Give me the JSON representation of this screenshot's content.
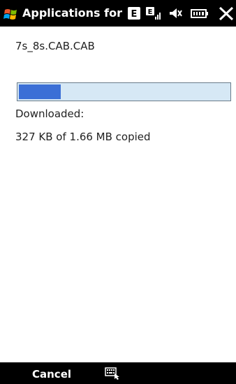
{
  "titlebar": {
    "title": "Applications for Ac",
    "icons": [
      "windows-flag-icon",
      "e-network-icon",
      "signal-icon",
      "speaker-muted-icon",
      "battery-icon",
      "close-icon"
    ]
  },
  "content": {
    "filename": "7s_8s.CAB.CAB",
    "progress_fraction": 0.2,
    "downloaded_label": "Downloaded:",
    "copied_text": "327 KB of 1.66 MB copied"
  },
  "menubar": {
    "left_label": "Cancel",
    "center_icon": "keyboard-input-icon"
  },
  "colors": {
    "bar_background": "#000000",
    "progress_fill": "#3b6fd6",
    "progress_track": "#d6e8f5"
  }
}
